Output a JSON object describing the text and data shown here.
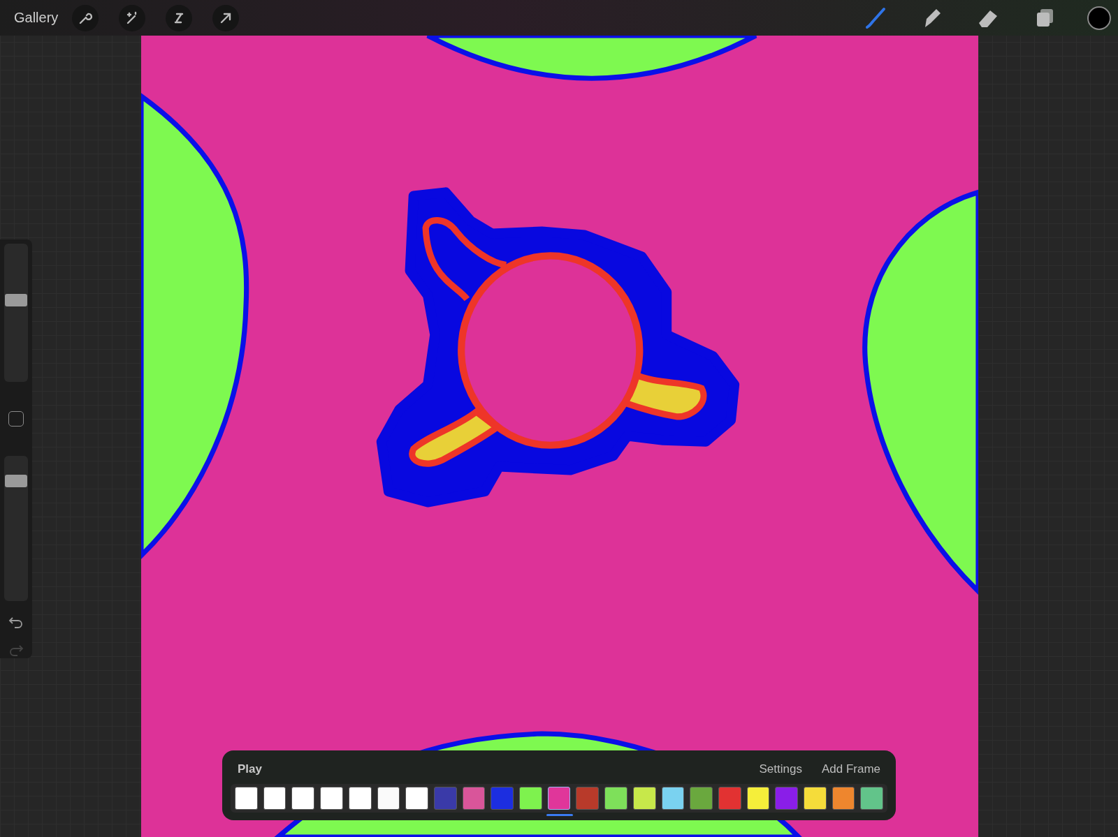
{
  "top_bar": {
    "gallery": "Gallery",
    "actions": [
      {
        "kind": "wrench"
      },
      {
        "kind": "wand"
      },
      {
        "kind": "selection"
      },
      {
        "kind": "transform"
      }
    ],
    "tools": [
      {
        "kind": "brush",
        "selected": true
      },
      {
        "kind": "smudge",
        "selected": false
      },
      {
        "kind": "eraser",
        "selected": false
      },
      {
        "kind": "layers",
        "selected": false
      }
    ],
    "color": "#000000"
  },
  "sidebar": {
    "sliders": [
      {
        "level": 0.6
      },
      {
        "level": 0.86
      }
    ],
    "undo": {
      "disabled": false
    },
    "redo": {
      "disabled": true
    }
  },
  "timeline": {
    "play": "Play",
    "settings": "Settings",
    "add_frame": "Add Frame",
    "frames": [
      {
        "color": "#ffffff",
        "selected": false
      },
      {
        "color": "#ffffff",
        "selected": false
      },
      {
        "color": "#ffffff",
        "selected": false
      },
      {
        "color": "#ffffff",
        "selected": false
      },
      {
        "color": "#ffffff",
        "selected": false
      },
      {
        "color": "#fafafa",
        "selected": false
      },
      {
        "color": "#ffffff",
        "selected": false
      },
      {
        "color": "#3a3aa8",
        "selected": false
      },
      {
        "color": "#d9559a",
        "selected": false
      },
      {
        "color": "#1c2ee0",
        "selected": false
      },
      {
        "color": "#7ef24e",
        "selected": false
      },
      {
        "color": "#e0369a",
        "selected": true
      },
      {
        "color": "#b83a2a",
        "selected": false
      },
      {
        "color": "#7ee05a",
        "selected": false
      },
      {
        "color": "#c7e84a",
        "selected": false
      },
      {
        "color": "#7ad2f0",
        "selected": false
      },
      {
        "color": "#6aa83e",
        "selected": false
      },
      {
        "color": "#e23232",
        "selected": false
      },
      {
        "color": "#f5ee3a",
        "selected": false
      },
      {
        "color": "#8a1ee8",
        "selected": false
      },
      {
        "color": "#f5dc3a",
        "selected": false
      },
      {
        "color": "#ee862e",
        "selected": false
      },
      {
        "color": "#62c48a",
        "selected": false
      }
    ]
  }
}
